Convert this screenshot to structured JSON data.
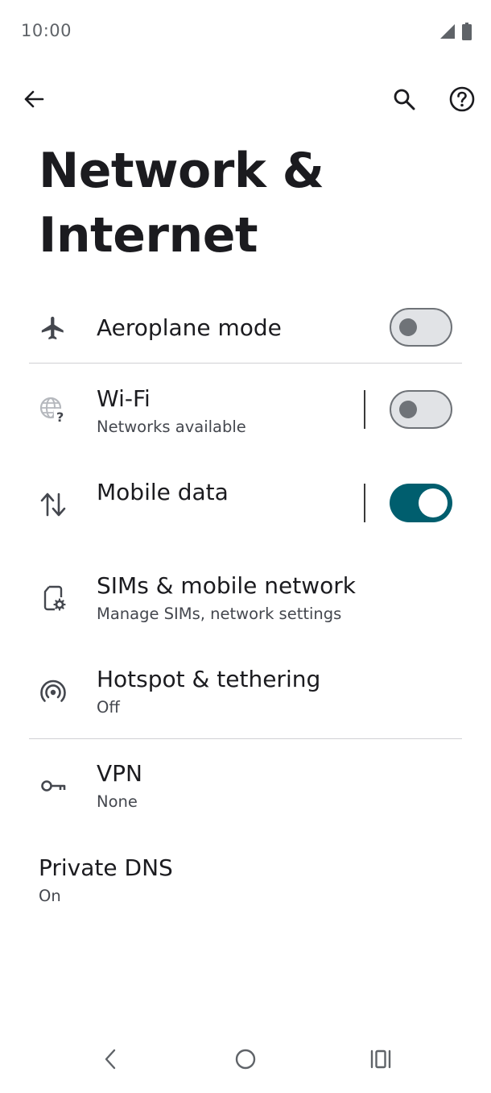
{
  "status_bar": {
    "time": "10:00",
    "icons": [
      "signal-icon",
      "battery-icon"
    ]
  },
  "app_bar": {
    "back_icon": "arrow-back-icon",
    "search_icon": "search-icon",
    "help_icon": "help-icon"
  },
  "page": {
    "title": "Network & Internet"
  },
  "items": [
    {
      "id": "aeroplane",
      "icon": "airplane-icon",
      "title": "Aeroplane mode",
      "subtitle": "",
      "toggle": false
    },
    {
      "id": "wifi",
      "icon": "wifi-globe-icon",
      "title": "Wi-Fi",
      "subtitle": "Networks available",
      "toggle": false
    },
    {
      "id": "mobile-data",
      "icon": "swap-vertical-icon",
      "title": "Mobile data",
      "subtitle": "",
      "toggle": true
    },
    {
      "id": "sims",
      "icon": "sim-settings-icon",
      "title": "SIMs & mobile network",
      "subtitle": "Manage SIMs, network settings"
    },
    {
      "id": "hotspot",
      "icon": "hotspot-icon",
      "title": "Hotspot & tethering",
      "subtitle": "Off"
    },
    {
      "id": "vpn",
      "icon": "vpn-key-icon",
      "title": "VPN",
      "subtitle": "None"
    },
    {
      "id": "private-dns",
      "icon": "",
      "title": "Private DNS",
      "subtitle": "On"
    }
  ],
  "nav_bar": {
    "icons": [
      "nav-back-icon",
      "nav-home-icon",
      "nav-recents-icon"
    ]
  },
  "colors": {
    "accent": "#005e6e",
    "switch_off_track": "#e1e3e6",
    "switch_off_outline": "#6f7378",
    "text_primary": "#1b1b1f",
    "text_secondary": "#44474e",
    "divider": "#d0d0d4"
  }
}
